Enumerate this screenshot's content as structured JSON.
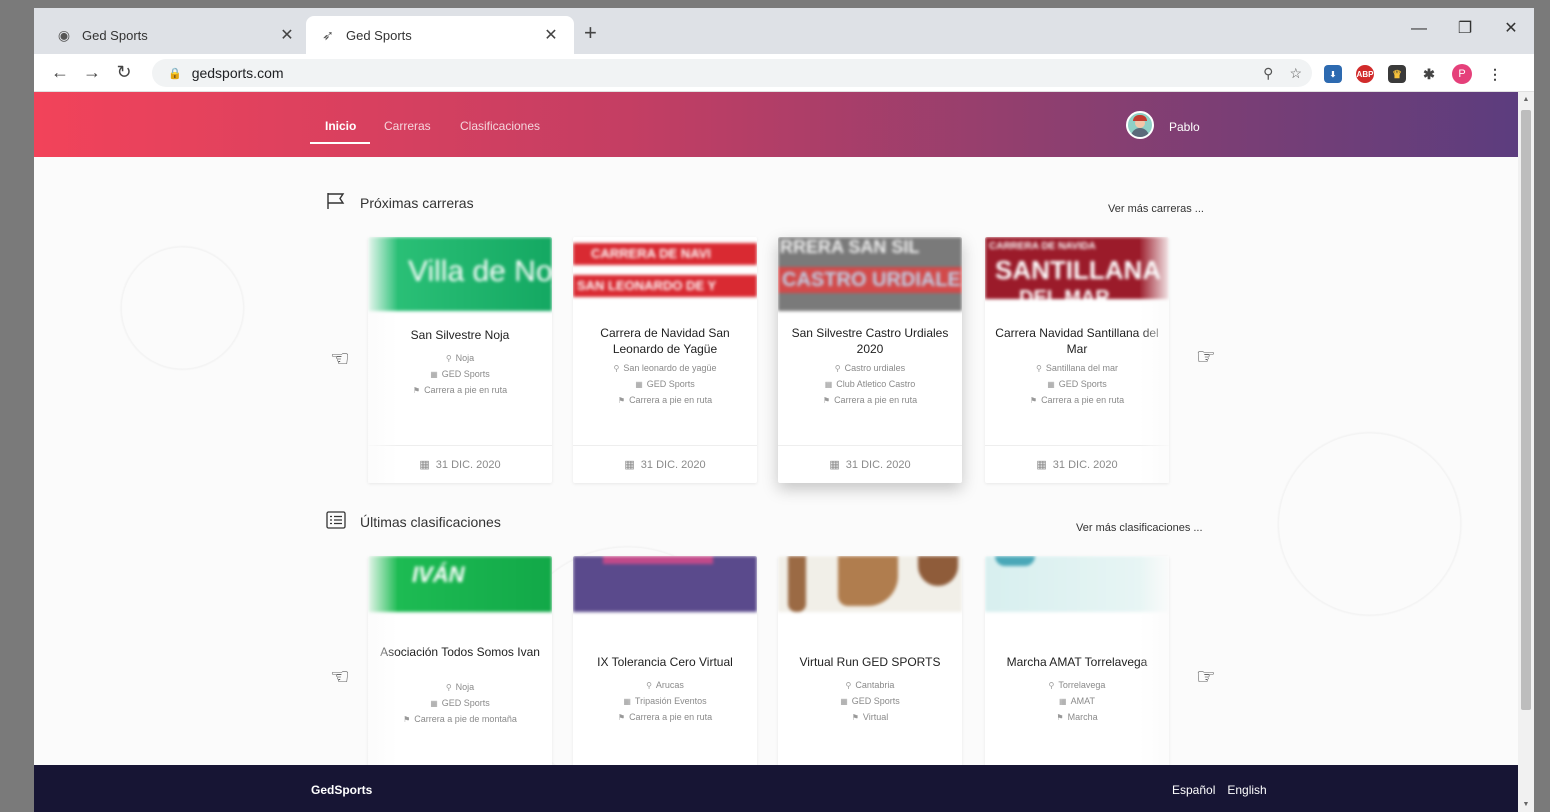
{
  "browser": {
    "tabs": [
      {
        "title": "Ged Sports",
        "icon": "globe-icon"
      },
      {
        "title": "Ged Sports",
        "icon": "runner-icon"
      }
    ],
    "url": "gedsports.com",
    "profile_initial": "P",
    "abp_label": "ABP"
  },
  "header": {
    "nav": [
      {
        "label": "Inicio",
        "active": true
      },
      {
        "label": "Carreras",
        "active": false
      },
      {
        "label": "Clasificaciones",
        "active": false
      }
    ],
    "user": "Pablo"
  },
  "upcoming": {
    "title": "Próximas carreras",
    "more": "Ver más carreras ...",
    "cards": [
      {
        "banner": "Villa de Noja",
        "title": "San Silvestre Noja",
        "location": "Noja",
        "organizer": "GED Sports",
        "category": "Carrera a pie en ruta",
        "date": "31 DIC. 2020"
      },
      {
        "banner": "CARRERA DE NAVI",
        "banner2": "SAN LEONARDO DE Y",
        "title": "Carrera de Navidad San Leonardo de Yagüe",
        "location": "San leonardo de yagüe",
        "organizer": "GED Sports",
        "category": "Carrera a pie en ruta",
        "date": "31 DIC. 2020"
      },
      {
        "banner": "RRERA SAN SIL",
        "banner2": "CASTRO URDIALE",
        "title": "San Silvestre Castro Urdiales 2020",
        "location": "Castro urdiales",
        "organizer": "Club Atletico Castro",
        "category": "Carrera a pie en ruta",
        "date": "31 DIC. 2020"
      },
      {
        "banner": "CARRERA DE NAVIDA",
        "banner2": "SANTILLANA",
        "banner3": "DEL MAR",
        "title": "Carrera Navidad Santillana del Mar",
        "location": "Santillana del mar",
        "organizer": "GED Sports",
        "category": "Carrera a pie en ruta",
        "date": "31 DIC. 2020"
      }
    ]
  },
  "results": {
    "title": "Últimas clasificaciones",
    "more": "Ver más clasificaciones ...",
    "cards": [
      {
        "banner": "IVÁN",
        "title": "Asociación Todos Somos Ivan",
        "location": "Noja",
        "organizer": "GED Sports",
        "category": "Carrera a pie de montaña"
      },
      {
        "title": "IX Tolerancia Cero Virtual",
        "location": "Arucas",
        "organizer": "Tripasión Eventos",
        "category": "Carrera a pie en ruta"
      },
      {
        "title": "Virtual Run GED SPORTS",
        "location": "Cantabria",
        "organizer": "GED Sports",
        "category": "Virtual"
      },
      {
        "title": "Marcha AMAT Torrelavega",
        "location": "Torrelavega",
        "organizer": "AMAT",
        "category": "Marcha"
      }
    ]
  },
  "footer": {
    "brand": "GedSports",
    "languages": [
      "Español",
      "English"
    ]
  }
}
